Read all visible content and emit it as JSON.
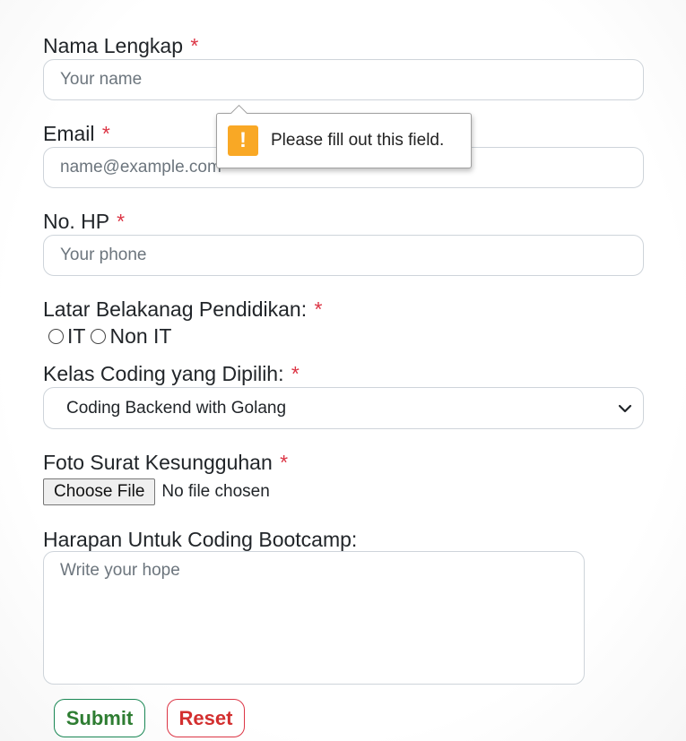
{
  "form": {
    "required_mark": "*",
    "name": {
      "label": "Nama Lengkap",
      "placeholder": "Your name",
      "value": ""
    },
    "email": {
      "label": "Email",
      "placeholder": "name@example.com",
      "value": ""
    },
    "phone": {
      "label": "No. HP",
      "placeholder": "Your phone",
      "value": ""
    },
    "education": {
      "label": "Latar Belakanag Pendidikan:",
      "options": [
        "IT",
        "Non IT"
      ]
    },
    "course": {
      "label": "Kelas Coding yang Dipilih:",
      "selected": "Coding Backend with Golang"
    },
    "photo": {
      "label": "Foto Surat Kesungguhan",
      "button_label": "Choose File",
      "status": "No file chosen"
    },
    "hope": {
      "label": "Harapan Untuk Coding Bootcamp:",
      "placeholder": "Write your hope",
      "value": ""
    },
    "submit_label": "Submit",
    "reset_label": "Reset"
  },
  "validation_tooltip": {
    "icon": "exclamation-warning-icon",
    "icon_glyph": "!",
    "message": "Please fill out this field."
  },
  "colors": {
    "required": "#dc3545",
    "submit": "#198754",
    "reset": "#dc3545",
    "warning": "#f9a825"
  }
}
